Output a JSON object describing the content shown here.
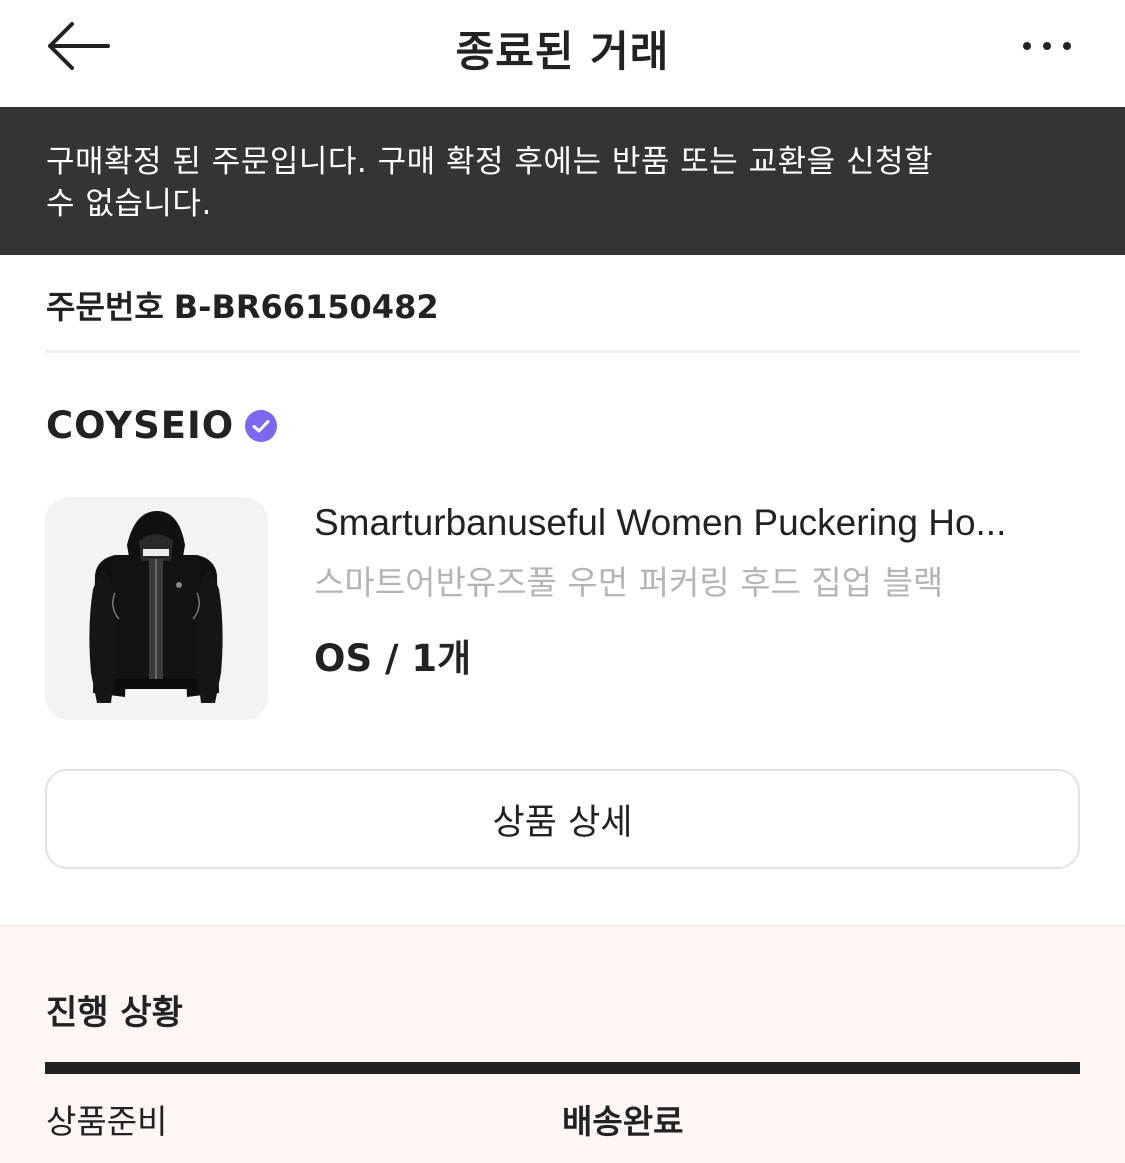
{
  "header": {
    "title": "종료된 거래",
    "back_icon": "arrow-left-icon",
    "more_icon": "more-horizontal-icon"
  },
  "notice": {
    "text_line1": "구매확정 된 주문입니다. 구매 확정 후에는 반품 또는 교환을 신청할",
    "text_line2": "수 없습니다."
  },
  "order": {
    "label": "주문번호",
    "number": "B-BR66150482"
  },
  "brand": {
    "name": "COYSEIO",
    "verified_icon": "verified-check-icon",
    "verified_color": "#7b68ee"
  },
  "product": {
    "name": "Smarturbanuseful Women Puckering Ho...",
    "name_ko": "스마트어반유즈풀 우먼 퍼커링 후드 집업 블랙",
    "option": "OS / 1개",
    "image_icon": "black-hoodie-image"
  },
  "detail_button": {
    "label": "상품 상세"
  },
  "progress": {
    "title": "진행 상황",
    "steps": [
      {
        "label": "상품준비",
        "active": false
      },
      {
        "label": "배송완료",
        "active": true
      }
    ],
    "fill_fraction": 1.0
  }
}
